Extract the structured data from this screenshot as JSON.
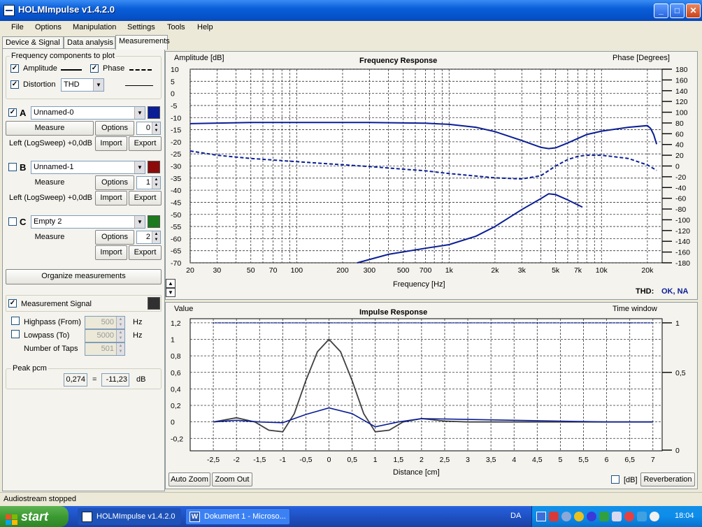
{
  "window": {
    "title": "HOLMImpulse  v1.4.2.0",
    "minimize": "_",
    "maximize": "□",
    "close": "✕"
  },
  "menu": [
    "File",
    "Options",
    "Manipulation",
    "Settings",
    "Tools",
    "Help"
  ],
  "tabs": [
    "Device & Signal",
    "Data analysis",
    "Measurements"
  ],
  "freq_components": {
    "title": "Frequency components to plot",
    "amplitude": "Amplitude",
    "phase": "Phase",
    "distortion": "Distortion",
    "distortion_type": "THD"
  },
  "measurements": [
    {
      "letter": "A",
      "name": "Unnamed-0",
      "checked": true,
      "color": "#0A1E96",
      "measure": "Measure",
      "options": "Options",
      "spin": "0",
      "info": "Left (LogSweep) +0,0dB",
      "import": "Import",
      "export": "Export"
    },
    {
      "letter": "B",
      "name": "Unnamed-1",
      "checked": false,
      "color": "#8B0A0A",
      "measure": "Measure",
      "options": "Options",
      "spin": "1",
      "info": "Left (LogSweep) +0,0dB",
      "import": "Import",
      "export": "Export"
    },
    {
      "letter": "C",
      "name": "Empty 2",
      "checked": false,
      "color": "#1E7A1E",
      "measure": "Measure",
      "options": "Options",
      "spin": "2",
      "info": "",
      "import": "Import",
      "export": "Export"
    }
  ],
  "organize": "Organize measurements",
  "signal": {
    "title": "Measurement Signal",
    "color": "#303030",
    "highpass": "Highpass (From)",
    "highpass_val": "500",
    "lowpass": "Lowpass (To)",
    "lowpass_val": "5000",
    "hz": "Hz",
    "taps": "Number of Taps",
    "taps_val": "501"
  },
  "peak": {
    "title": "Peak pcm",
    "value": "0,274",
    "eq": "=",
    "db_value": "-11,23",
    "db": "dB"
  },
  "freq_plot": {
    "title": "Frequency Response",
    "left_label": "Amplitude [dB]",
    "right_label": "Phase [Degrees]",
    "xlabel": "Frequency [Hz]",
    "thd_label": "THD:",
    "thd_status": "OK, NA"
  },
  "impulse_plot": {
    "title": "Impulse Response",
    "left_label": "Value",
    "right_label": "Time window",
    "xlabel": "Distance [cm]",
    "auto_zoom": "Auto Zoom",
    "zoom_out": "Zoom Out",
    "db": "[dB]",
    "reverberation": "Reverberation"
  },
  "chart_data": [
    {
      "type": "line",
      "title": "Frequency Response",
      "ylabel": "Amplitude [dB]",
      "y2label": "Phase [Degrees]",
      "xlabel": "Frequency [Hz]",
      "xscale": "log",
      "xlim": [
        20,
        25000
      ],
      "ylim": [
        -70,
        10
      ],
      "y2lim": [
        -180,
        180
      ],
      "grid": true,
      "xticks": [
        20,
        30,
        50,
        70,
        100,
        200,
        300,
        500,
        700,
        1000,
        2000,
        3000,
        5000,
        7000,
        10000,
        20000
      ],
      "xticklabels": [
        "20",
        "30",
        "50",
        "70",
        "100",
        "200",
        "300",
        "500",
        "700",
        "1k",
        "2k",
        "3k",
        "5k",
        "7k",
        "10k",
        "20k"
      ],
      "yticks": [
        10,
        5,
        0,
        -5,
        -10,
        -15,
        -20,
        -25,
        -30,
        -35,
        -40,
        -45,
        -50,
        -55,
        -60,
        -65,
        -70
      ],
      "y2ticks": [
        180,
        160,
        140,
        120,
        100,
        80,
        60,
        40,
        20,
        0,
        -20,
        -40,
        -60,
        -80,
        -100,
        -120,
        -140,
        -160,
        -180
      ],
      "series": [
        {
          "role": "amplitude",
          "axis": "left",
          "x": [
            20,
            50,
            100,
            300,
            700,
            1000,
            1500,
            2000,
            3000,
            4000,
            4500,
            5000,
            6000,
            8000,
            10000,
            15000,
            20000,
            21000,
            22000,
            23000
          ],
          "y": [
            -12.5,
            -12,
            -12,
            -12,
            -12.3,
            -12.8,
            -14,
            -15.8,
            -19.5,
            -22.3,
            -22.8,
            -22.5,
            -20.5,
            -17,
            -15.6,
            -14,
            -13.3,
            -14.5,
            -17,
            -21
          ]
        },
        {
          "role": "phase",
          "axis": "right",
          "x": [
            20,
            30,
            50,
            100,
            300,
            700,
            1000,
            2000,
            3000,
            4000,
            5000,
            6000,
            7000,
            8000,
            10000,
            15000,
            20000,
            23000
          ],
          "y": [
            28,
            20,
            14,
            8,
            -1,
            -9,
            -14,
            -22,
            -24,
            -18,
            0,
            12,
            18,
            20,
            20,
            14,
            2,
            -8
          ]
        },
        {
          "role": "distortion",
          "axis": "left",
          "x": [
            250,
            400,
            700,
            1000,
            1500,
            2000,
            3000,
            4000,
            4500,
            5000,
            6000,
            7500
          ],
          "y": [
            -70,
            -66.5,
            -64,
            -62.5,
            -59,
            -55,
            -48,
            -43.5,
            -41.5,
            -41.8,
            -44,
            -47
          ]
        }
      ]
    },
    {
      "type": "line",
      "title": "Impulse Response",
      "ylabel": "Value",
      "y2label": "Time window",
      "xlabel": "Distance [cm]",
      "xlim": [
        -3,
        7.2
      ],
      "ylim": [
        -0.35,
        1.25
      ],
      "y2lim": [
        0,
        1
      ],
      "grid": true,
      "xticks": [
        -2.5,
        -2,
        -1.5,
        -1,
        -0.5,
        0,
        0.5,
        1,
        1.5,
        2,
        2.5,
        3,
        3.5,
        4,
        4.5,
        5,
        5.5,
        6,
        6.5,
        7
      ],
      "xticklabels": [
        "-2,5",
        "-2",
        "-1,5",
        "-1",
        "-0,5",
        "0",
        "0,5",
        "1",
        "1,5",
        "2",
        "2,5",
        "3",
        "3,5",
        "4",
        "4,5",
        "5",
        "5,5",
        "6",
        "6,5",
        "7"
      ],
      "yticks": [
        1.2,
        1,
        0.8,
        0.6,
        0.4,
        0.2,
        0,
        -0.2
      ],
      "yticklabels": [
        "1,2",
        "1",
        "0,8",
        "0,6",
        "0,4",
        "0,2",
        "0",
        "-0,2"
      ],
      "y2ticks": [
        1,
        0.5,
        0
      ],
      "y2ticklabels": [
        "1",
        "0,5",
        "0"
      ],
      "series": [
        {
          "role": "impulse-raw",
          "axis": "left",
          "x": [
            -2.5,
            -2,
            -1.6,
            -1.3,
            -1,
            -0.75,
            -0.5,
            -0.25,
            0,
            0.25,
            0.5,
            0.75,
            1,
            1.3,
            1.6,
            2,
            2.5,
            3,
            4,
            5,
            6,
            7
          ],
          "y": [
            0,
            0.05,
            0,
            -0.1,
            -0.12,
            0.1,
            0.5,
            0.85,
            1.0,
            0.85,
            0.5,
            0.1,
            -0.12,
            -0.1,
            0,
            0.04,
            0.01,
            0,
            0,
            0,
            0,
            0
          ]
        },
        {
          "role": "impulse-windowed",
          "axis": "left",
          "x": [
            -2.5,
            -2,
            -1.5,
            -1,
            -0.5,
            0,
            0.5,
            1,
            1.5,
            2,
            3,
            4,
            5,
            6,
            7
          ],
          "y": [
            0,
            0.02,
            0,
            -0.01,
            0.09,
            0.17,
            0.1,
            -0.06,
            0,
            0.04,
            0.03,
            0.02,
            0.01,
            0,
            0
          ]
        },
        {
          "role": "time-window",
          "axis": "right",
          "x": [
            -2.5,
            7
          ],
          "y": [
            1,
            1
          ]
        }
      ]
    }
  ],
  "status": "Audiostream stopped",
  "taskbar": {
    "start": "start",
    "items": [
      "HOLMImpulse  v1.4.2.0",
      "Dokument 1 - Microso..."
    ],
    "lang": "DA",
    "clock": "18:04"
  }
}
